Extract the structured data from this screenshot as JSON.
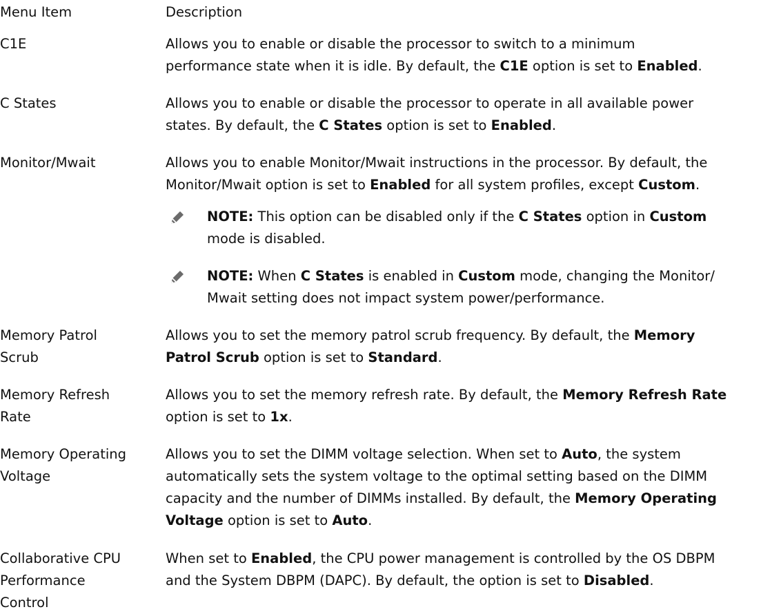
{
  "table": {
    "header": {
      "menu_item": "Menu Item",
      "description": "Description"
    },
    "rows": [
      {
        "term": "C1E",
        "desc": [
          {
            "t": "Allows you to enable or disable the processor to switch to a minimum"
          },
          {
            "br": true
          },
          {
            "t": "performance state when it is idle. By default, the "
          },
          {
            "b": "C1E"
          },
          {
            "t": " option is set to "
          },
          {
            "b": "Enabled"
          },
          {
            "t": "."
          }
        ]
      },
      {
        "term": "C States",
        "desc": [
          {
            "t": "Allows you to enable or disable the processor to operate in all available power"
          },
          {
            "br": true
          },
          {
            "t": "states. By default, the "
          },
          {
            "b": "C States"
          },
          {
            "t": " option is set to "
          },
          {
            "b": "Enabled"
          },
          {
            "t": "."
          }
        ]
      },
      {
        "term": "Monitor/Mwait",
        "desc": [
          {
            "t": "Allows you to enable Monitor/Mwait instructions in the processor. By default, the"
          },
          {
            "br": true
          },
          {
            "t": "Monitor/Mwait option is set to "
          },
          {
            "b": "Enabled"
          },
          {
            "t": " for all system profiles, except "
          },
          {
            "b": "Custom"
          },
          {
            "t": "."
          }
        ],
        "notes": [
          [
            {
              "b": "NOTE:"
            },
            {
              "t": " This option can be disabled only if the "
            },
            {
              "b": "C States"
            },
            {
              "t": " option in "
            },
            {
              "b": "Custom"
            },
            {
              "br": true
            },
            {
              "t": "mode is disabled."
            }
          ],
          [
            {
              "b": "NOTE:"
            },
            {
              "t": " When "
            },
            {
              "b": "C States"
            },
            {
              "t": " is enabled in "
            },
            {
              "b": "Custom"
            },
            {
              "t": " mode, changing the Monitor/"
            },
            {
              "br": true
            },
            {
              "t": "Mwait setting does not impact system power/performance."
            }
          ]
        ]
      },
      {
        "term": "Memory Patrol Scrub",
        "term_lines": [
          "Memory Patrol",
          "Scrub"
        ],
        "desc": [
          {
            "t": "Allows you to set the memory patrol scrub frequency. By default, the "
          },
          {
            "b": "Memory"
          },
          {
            "br": true
          },
          {
            "b": "Patrol Scrub"
          },
          {
            "t": " option is set to "
          },
          {
            "b": "Standard"
          },
          {
            "t": "."
          }
        ]
      },
      {
        "term": "Memory Refresh Rate",
        "term_lines": [
          "Memory Refresh",
          "Rate"
        ],
        "desc": [
          {
            "t": "Allows you to set the memory refresh rate. By default, the "
          },
          {
            "b": "Memory Refresh Rate"
          },
          {
            "br": true
          },
          {
            "t": "option is set to "
          },
          {
            "b": "1x"
          },
          {
            "t": "."
          }
        ]
      },
      {
        "term": "Memory Operating Voltage",
        "term_lines": [
          "Memory Operating",
          "Voltage"
        ],
        "desc": [
          {
            "t": "Allows you to set the DIMM voltage selection. When set to "
          },
          {
            "b": "Auto"
          },
          {
            "t": ", the system"
          },
          {
            "br": true
          },
          {
            "t": "automatically sets the system voltage to the optimal setting based on the DIMM"
          },
          {
            "br": true
          },
          {
            "t": "capacity and the number of DIMMs installed. By default, the "
          },
          {
            "b": "Memory Operating"
          },
          {
            "br": true
          },
          {
            "b": "Voltage"
          },
          {
            "t": " option is set to "
          },
          {
            "b": "Auto"
          },
          {
            "t": "."
          }
        ]
      },
      {
        "term": "Collaborative CPU Performance Control",
        "term_lines": [
          "Collaborative CPU",
          "Performance",
          "Control"
        ],
        "desc": [
          {
            "t": "When set to "
          },
          {
            "b": "Enabled"
          },
          {
            "t": ", the CPU power management is controlled by the OS DBPM"
          },
          {
            "br": true
          },
          {
            "t": "and the System DBPM (DAPC). By default, the option is set to "
          },
          {
            "b": "Disabled"
          },
          {
            "t": "."
          }
        ]
      }
    ]
  },
  "icons": {
    "note": "pencil-note-icon"
  },
  "colors": {
    "text": "#111111",
    "icon": "#6b6b6b"
  }
}
